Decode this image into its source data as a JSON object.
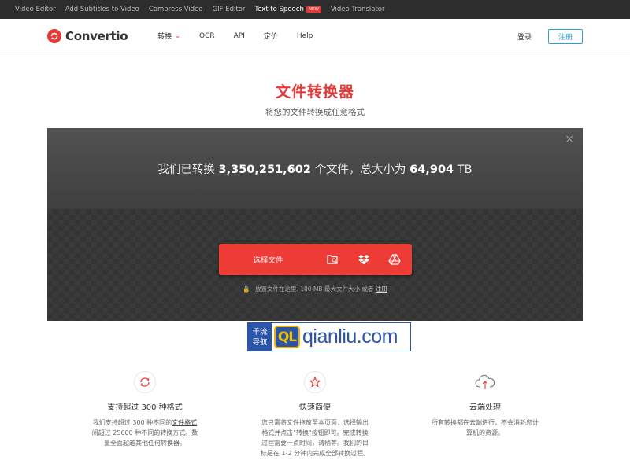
{
  "topbar": {
    "links": [
      "Video Editor",
      "Add Subtitles to Video",
      "Compress Video",
      "GIF Editor",
      "Text to Speech",
      "Video Translator"
    ],
    "new_badge": "NEW"
  },
  "brand": {
    "name": "Convertio",
    "color": "#e53935"
  },
  "nav": {
    "items": [
      "转换",
      "OCR",
      "API",
      "定价",
      "Help"
    ],
    "login": "登录",
    "signup": "注册"
  },
  "hero": {
    "title": "文件转换器",
    "subtitle": "将您的文件转换成任意格式"
  },
  "upload": {
    "close": "×",
    "stats_prefix": "我们已转换",
    "files_count": "3,350,251,602",
    "stats_mid": "个文件，总大小为",
    "total_size": "64,904",
    "stats_unit": "TB",
    "choose_label": "选择文件",
    "drop_note": "放置文件在这里. 100 MB 最大文件大小 或者",
    "drop_register": "注册",
    "icons": [
      "folder-search-icon",
      "dropbox-icon",
      "google-drive-icon"
    ]
  },
  "watermark": {
    "cn_line1": "千流",
    "cn_line2": "导航",
    "mark": "QL",
    "site": "qianliu.com"
  },
  "features": [
    {
      "icon": "refresh-icon",
      "title": "支持超过 300 种格式",
      "line1_pre": "我们支持超过 300 种不同的",
      "line1_link": "文件格式",
      "line2": "间超过 25600 种不同的转换方式。数",
      "line3": "量全面超越其他任何转换器。",
      "line4": ""
    },
    {
      "icon": "star-icon",
      "title": "快速简便",
      "line1_pre": "您只需将文件拖放至本页面，选择输出",
      "line1_link": "",
      "line2": "格式并点击\"转换\"按钮即可。完成转换",
      "line3": "过程需要一点时间，请稍等。我们的目",
      "line4": "标是在 1-2 分钟内完成全部转换过程。"
    },
    {
      "icon": "cloud-upload-icon",
      "title": "云端处理",
      "line1_pre": "所有转换都在云端进行，不会消耗您计",
      "line1_link": "",
      "line2": "算机的资源。",
      "line3": "",
      "line4": ""
    }
  ]
}
